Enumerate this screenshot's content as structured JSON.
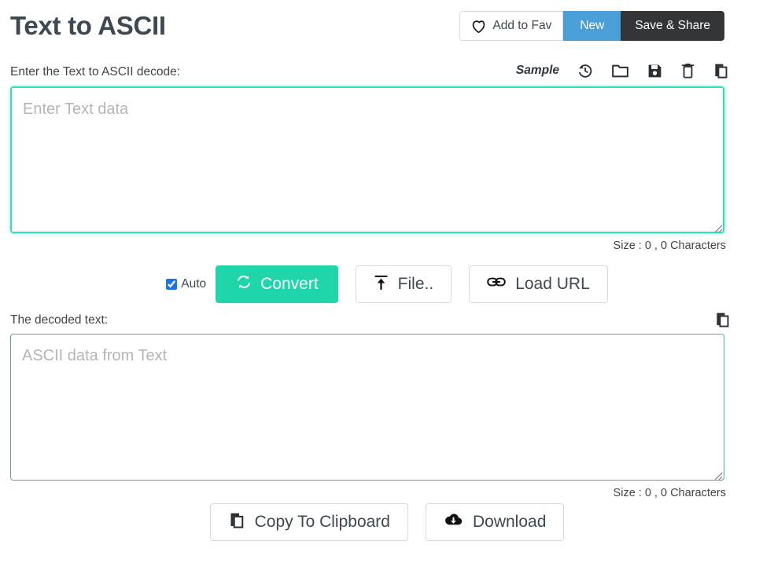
{
  "header": {
    "title": "Text to ASCII",
    "buttons": {
      "add_to_fav": "Add to Fav",
      "new": "New",
      "save_share": "Save & Share"
    }
  },
  "input_section": {
    "label": "Enter the Text to ASCII decode:",
    "toolbar": {
      "sample": "Sample",
      "icons": [
        "history-icon",
        "folder-open-icon",
        "save-disk-icon",
        "trash-icon",
        "copy-icon"
      ]
    },
    "textarea_placeholder": "Enter Text data",
    "textarea_value": "",
    "size_info": "Size : 0 , 0 Characters"
  },
  "actions": {
    "auto_label": "Auto",
    "auto_checked": true,
    "convert": "Convert",
    "file": "File..",
    "load_url": "Load URL"
  },
  "output_section": {
    "label": "The decoded text:",
    "copy_icon": "copy-icon",
    "textarea_placeholder": "ASCII data from Text",
    "textarea_value": "",
    "size_info": "Size : 0 , 0 Characters"
  },
  "bottom_actions": {
    "copy_to_clipboard": "Copy To Clipboard",
    "download": "Download"
  },
  "colors": {
    "accent_teal": "#1fd6aa",
    "focus_teal": "#30e0b8",
    "blue": "#4a9fd8",
    "dark": "#333537",
    "output_border": "#5b9ccf",
    "title": "#3d4852"
  }
}
